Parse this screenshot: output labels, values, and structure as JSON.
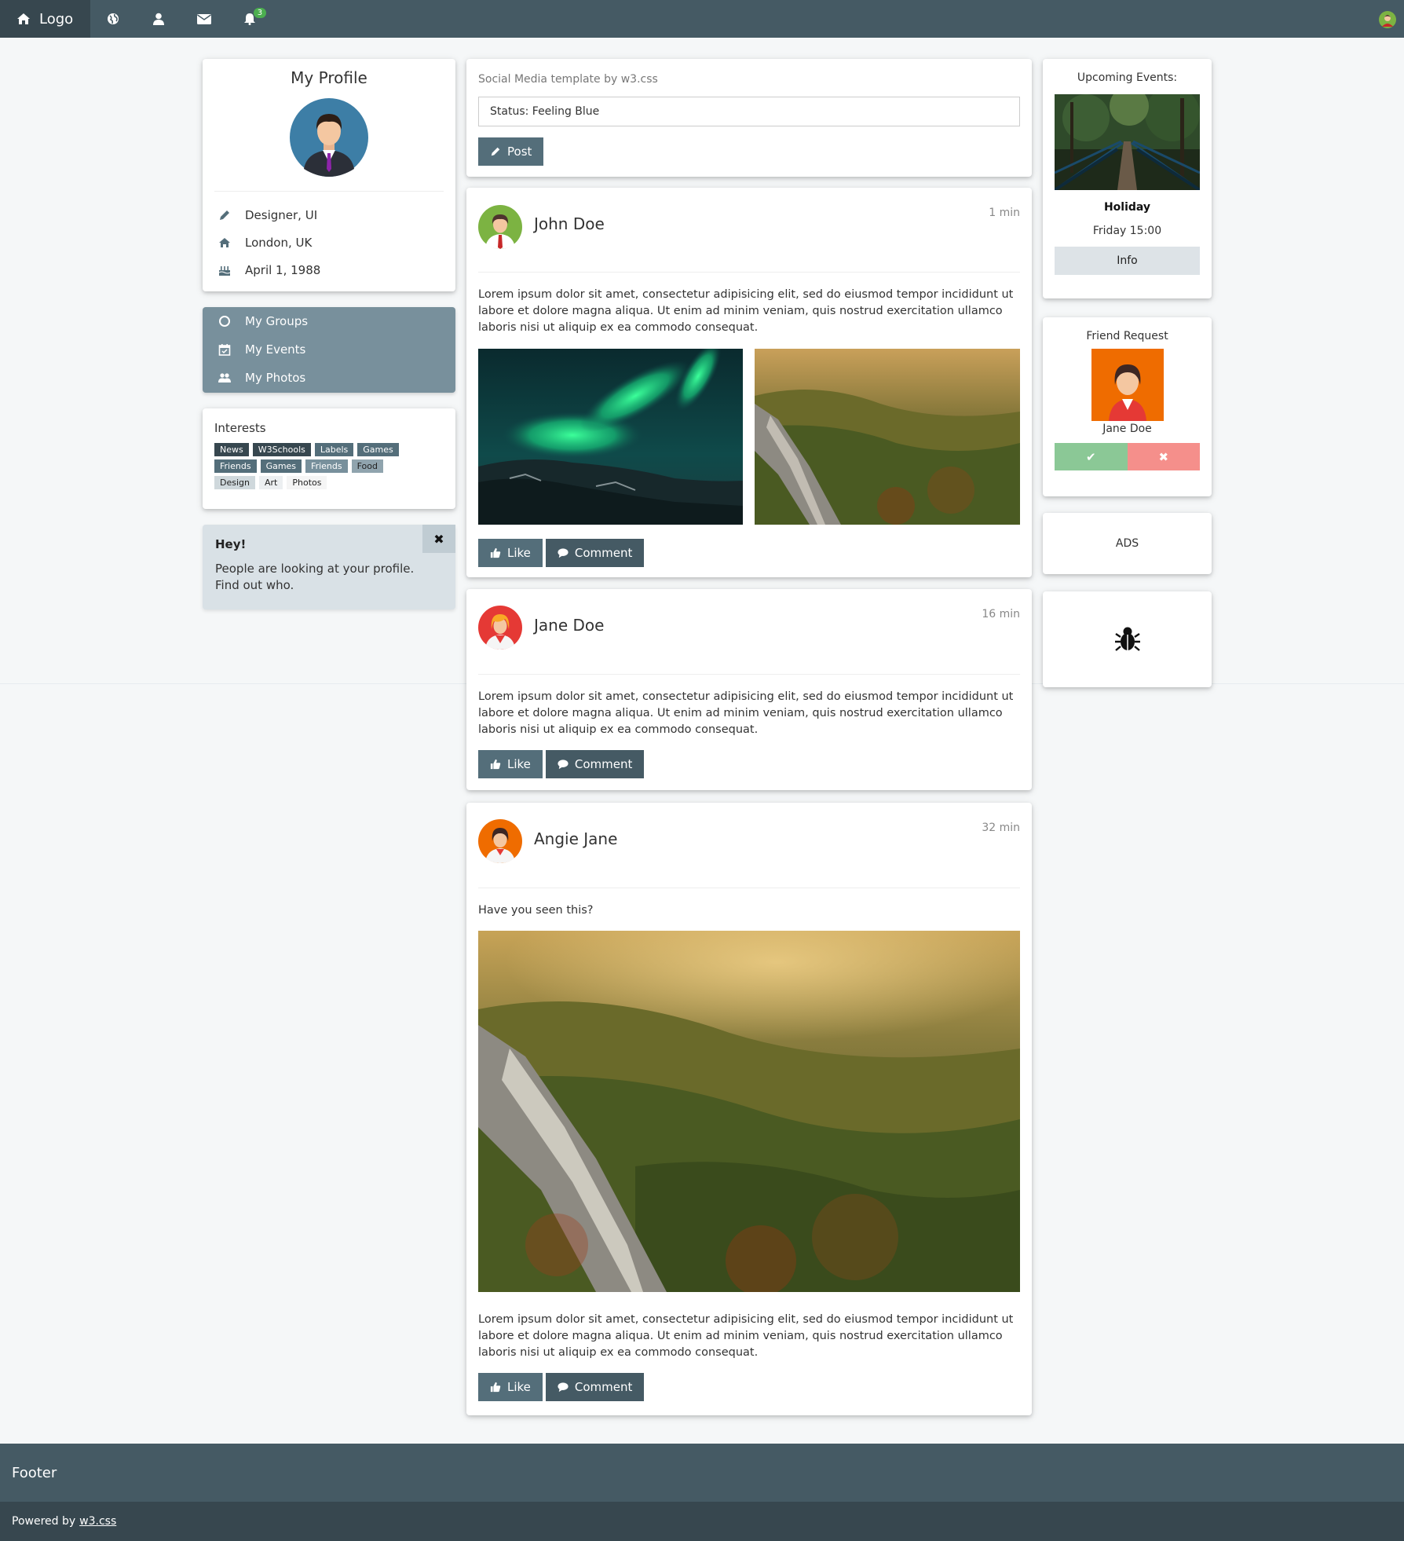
{
  "nav": {
    "logo_label": "Logo",
    "icons": [
      "home-icon",
      "globe-icon",
      "user-icon",
      "envelope-icon",
      "bell-icon"
    ],
    "notification_count": "3"
  },
  "profile": {
    "title": "My Profile",
    "job": "Designer, UI",
    "location": "London, UK",
    "birthday": "April 1, 1988"
  },
  "menu": {
    "items": [
      {
        "label": "My Groups",
        "icon": "circle-icon"
      },
      {
        "label": "My Events",
        "icon": "calendar-icon"
      },
      {
        "label": "My Photos",
        "icon": "users-icon"
      }
    ]
  },
  "interests": {
    "title": "Interests",
    "tags": [
      "News",
      "W3Schools",
      "Labels",
      "Games",
      "Friends",
      "Games",
      "Friends",
      "Food",
      "Design",
      "Art",
      "Photos"
    ]
  },
  "hey": {
    "title": "Hey!",
    "text": "People are looking at your profile. Find out who.",
    "close_label": "✖"
  },
  "status": {
    "heading": "Social Media template by w3.css",
    "input_value": "Status: Feeling Blue",
    "post_label": "Post"
  },
  "posts": [
    {
      "name": "John Doe",
      "time": "1 min",
      "text": "Lorem ipsum dolor sit amet, consectetur adipisicing elit, sed do eiusmod tempor incididunt ut labore et dolore magna aliqua. Ut enim ad minim veniam, quis nostrud exercitation ullamco laboris nisi ut aliquip ex ea commodo consequat.",
      "like_label": "Like",
      "comment_label": "Comment"
    },
    {
      "name": "Jane Doe",
      "time": "16 min",
      "text": "Lorem ipsum dolor sit amet, consectetur adipisicing elit, sed do eiusmod tempor incididunt ut labore et dolore magna aliqua. Ut enim ad minim veniam, quis nostrud exercitation ullamco laboris nisi ut aliquip ex ea commodo consequat.",
      "like_label": "Like",
      "comment_label": "Comment"
    },
    {
      "name": "Angie Jane",
      "time": "32 min",
      "intro": "Have you seen this?",
      "text": "Lorem ipsum dolor sit amet, consectetur adipisicing elit, sed do eiusmod tempor incididunt ut labore et dolore magna aliqua. Ut enim ad minim veniam, quis nostrud exercitation ullamco laboris nisi ut aliquip ex ea commodo consequat.",
      "like_label": "Like",
      "comment_label": "Comment"
    }
  ],
  "events": {
    "title": "Upcoming Events:",
    "name": "Holiday",
    "when": "Friday 15:00",
    "info_label": "Info"
  },
  "friend_request": {
    "title": "Friend Request",
    "name": "Jane Doe",
    "accept_label": "✔",
    "decline_label": "✖"
  },
  "ads": {
    "label": "ADS"
  },
  "footer": {
    "title": "Footer",
    "powered_prefix": "Powered by",
    "powered_link": "w3.css"
  }
}
